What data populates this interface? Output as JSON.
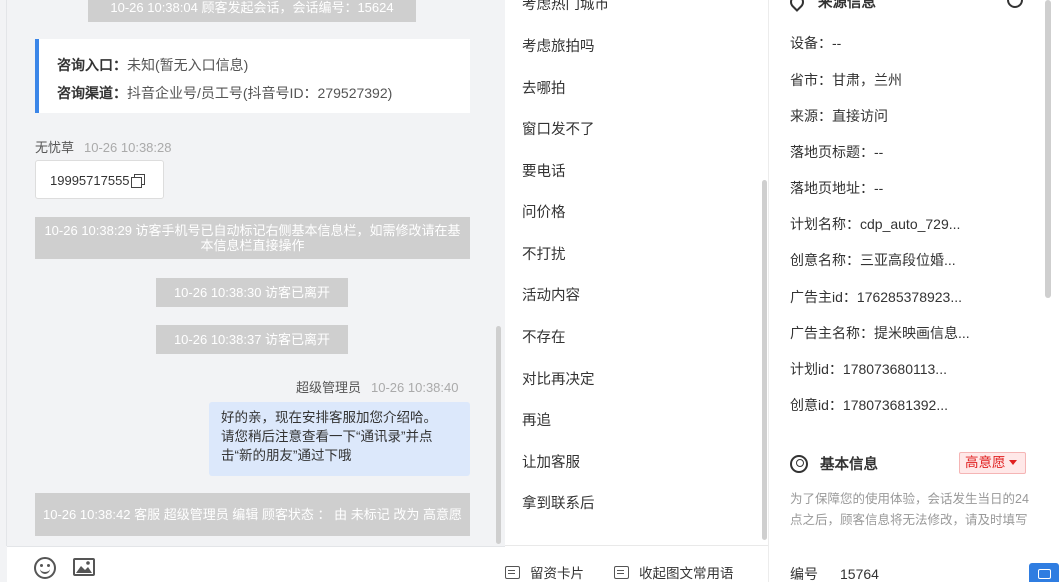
{
  "chat": {
    "top_system": "10-26 10:38:04 顾客发起会话，会话编号：15624",
    "consult": {
      "entry_label": "咨询入口：",
      "entry_value": "未知(暂无入口信息)",
      "channel_label": "咨询渠道：",
      "channel_value": "抖音企业号/员工号(抖音号ID：279527392)"
    },
    "visitor_msg": {
      "sender": "无忧草",
      "time": "10-26 10:38:28",
      "phone": "19995717555"
    },
    "system_msgs": [
      "10-26 10:38:29 访客手机号已自动标记右侧基本信息栏，如需修改请在基本信息栏直接操作",
      "10-26 10:38:30 访客已离开",
      "10-26 10:38:37 访客已离开",
      "10-26 10:38:42 客服 超级管理员 编辑 顾客状态 ： 由 未标记 改为 高意愿"
    ],
    "agent_msg": {
      "sender": "超级管理员",
      "time": "10-26 10:38:40",
      "lines": [
        "好的亲，现在安排客服加您介绍哈。",
        "请您稍后注意查看一下“通讯录”并点",
        "击“新的朋友”通过下哦"
      ]
    }
  },
  "phrases": {
    "items": [
      "考虑热门城市",
      "考虑旅拍吗",
      "去哪拍",
      "窗口发不了",
      "要电话",
      "问价格",
      "不打扰",
      "活动内容",
      "不存在",
      "对比再决定",
      "再追",
      "让加客服",
      "拿到联系后"
    ],
    "actions": {
      "card": "留资卡片",
      "collapse": "收起图文常用语"
    }
  },
  "info": {
    "source_title": "来源信息",
    "source": [
      {
        "label": "设备：",
        "value": "--"
      },
      {
        "label": "省市：",
        "value": "甘肃，兰州"
      },
      {
        "label": "来源：",
        "value": "直接访问"
      },
      {
        "label": "落地页标题：",
        "value": "--"
      },
      {
        "label": "落地页地址：",
        "value": "--"
      },
      {
        "label": "计划名称：",
        "value": "cdp_auto_729..."
      },
      {
        "label": "创意名称：",
        "value": "三亚高段位婚..."
      },
      {
        "label": "广告主id：",
        "value": "176285378923..."
      },
      {
        "label": "广告主名称：",
        "value": "提米映画信息..."
      },
      {
        "label": "计划id：",
        "value": "178073680113..."
      },
      {
        "label": "创意id：",
        "value": "178073681392..."
      }
    ],
    "basic_title": "基本信息",
    "intent_badge": "高意愿",
    "notice": "为了保障您的使用体验，会话发生当日的24点之后，顾客信息将无法修改，请及时填写",
    "id_label": "编号",
    "id_value": "15764"
  },
  "colors": {
    "accent": "#3b86e8",
    "badge_red": "#e02020",
    "system_gray": "#cfcfcf",
    "agent_bubble": "#dce8fb"
  }
}
